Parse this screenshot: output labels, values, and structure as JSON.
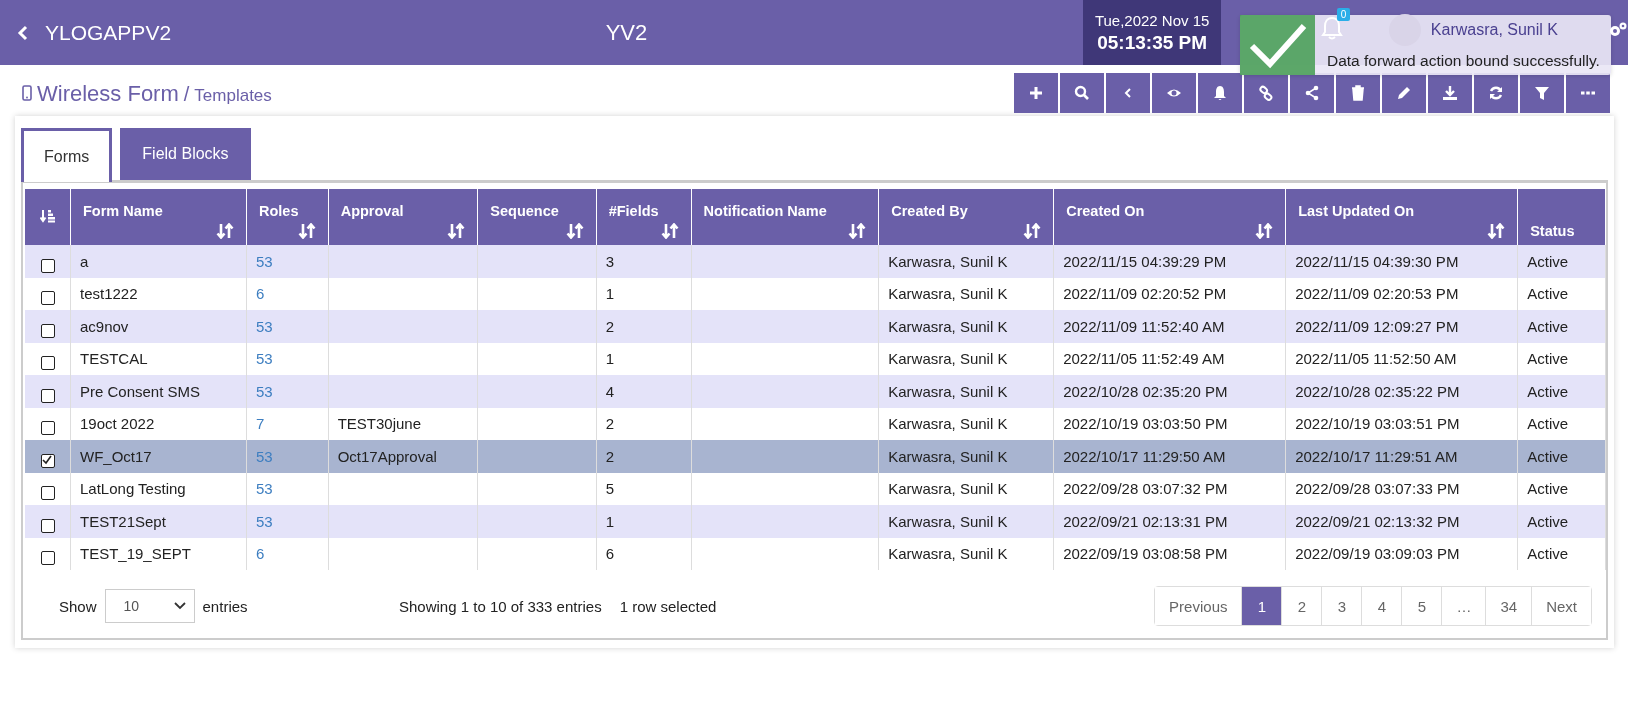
{
  "header": {
    "app_title": "YLOGAPPV2",
    "center_title": "YV2",
    "date": "Tue,2022 Nov 15",
    "time": "05:13:35 PM",
    "notification_badge": "0",
    "user_name": "Karwasra, Sunil K"
  },
  "toast": {
    "message": "Data forward action bound successfully."
  },
  "breadcrumb": {
    "title": "Wireless Form",
    "separator": "/",
    "subtitle": "Templates"
  },
  "tabs": [
    {
      "label": "Forms",
      "selected": true
    },
    {
      "label": "Field Blocks",
      "selected": false
    }
  ],
  "table": {
    "columns": [
      "Form Name",
      "Roles",
      "Approval",
      "Sequence",
      "#Fields",
      "Notification Name",
      "Created By",
      "Created On",
      "Last Updated On",
      "Status"
    ],
    "rows": [
      {
        "selected": false,
        "cells": [
          "a",
          "53",
          "",
          "",
          "3",
          "",
          "Karwasra, Sunil K",
          "2022/11/15 04:39:29 PM",
          "2022/11/15 04:39:30 PM",
          "Active"
        ]
      },
      {
        "selected": false,
        "cells": [
          "test1222",
          "6",
          "",
          "",
          "1",
          "",
          "Karwasra, Sunil K",
          "2022/11/09 02:20:52 PM",
          "2022/11/09 02:20:53 PM",
          "Active"
        ]
      },
      {
        "selected": false,
        "cells": [
          "ac9nov",
          "53",
          "",
          "",
          "2",
          "",
          "Karwasra, Sunil K",
          "2022/11/09 11:52:40 AM",
          "2022/11/09 12:09:27 PM",
          "Active"
        ]
      },
      {
        "selected": false,
        "cells": [
          "TESTCAL",
          "53",
          "",
          "",
          "1",
          "",
          "Karwasra, Sunil K",
          "2022/11/05 11:52:49 AM",
          "2022/11/05 11:52:50 AM",
          "Active"
        ]
      },
      {
        "selected": false,
        "cells": [
          "Pre Consent SMS",
          "53",
          "",
          "",
          "4",
          "",
          "Karwasra, Sunil K",
          "2022/10/28 02:35:20 PM",
          "2022/10/28 02:35:22 PM",
          "Active"
        ]
      },
      {
        "selected": false,
        "cells": [
          "19oct 2022",
          "7",
          "TEST30june",
          "",
          "2",
          "",
          "Karwasra, Sunil K",
          "2022/10/19 03:03:50 PM",
          "2022/10/19 03:03:51 PM",
          "Active"
        ]
      },
      {
        "selected": true,
        "cells": [
          "WF_Oct17",
          "53",
          "Oct17Approval",
          "",
          "2",
          "",
          "Karwasra, Sunil K",
          "2022/10/17 11:29:50 AM",
          "2022/10/17 11:29:51 AM",
          "Active"
        ]
      },
      {
        "selected": false,
        "cells": [
          "LatLong Testing",
          "53",
          "",
          "",
          "5",
          "",
          "Karwasra, Sunil K",
          "2022/09/28 03:07:32 PM",
          "2022/09/28 03:07:33 PM",
          "Active"
        ]
      },
      {
        "selected": false,
        "cells": [
          "TEST21Sept",
          "53",
          "",
          "",
          "1",
          "",
          "Karwasra, Sunil K",
          "2022/09/21 02:13:31 PM",
          "2022/09/21 02:13:32 PM",
          "Active"
        ]
      },
      {
        "selected": false,
        "cells": [
          "TEST_19_SEPT",
          "6",
          "",
          "",
          "6",
          "",
          "Karwasra, Sunil K",
          "2022/09/19 03:08:58 PM",
          "2022/09/19 03:09:03 PM",
          "Active"
        ]
      }
    ]
  },
  "footer": {
    "show_label": "Show",
    "page_size": "10",
    "entries_label": "entries",
    "info": "Showing 1 to 10 of 333 entries",
    "selection_info": "1 row selected"
  },
  "pagination": [
    {
      "label": "Previous",
      "selected": false
    },
    {
      "label": "1",
      "selected": true
    },
    {
      "label": "2",
      "selected": false
    },
    {
      "label": "3",
      "selected": false
    },
    {
      "label": "4",
      "selected": false
    },
    {
      "label": "5",
      "selected": false
    },
    {
      "label": "…",
      "selected": false
    },
    {
      "label": "34",
      "selected": false
    },
    {
      "label": "Next",
      "selected": false
    }
  ]
}
